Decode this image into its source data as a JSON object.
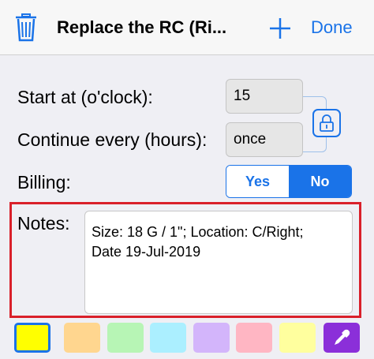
{
  "nav": {
    "title": "Replace the RC (Ri...",
    "done_label": "Done"
  },
  "form": {
    "start_label": "Start at (o'clock):",
    "start_value": "15",
    "continue_label": "Continue every (hours):",
    "continue_value": "once",
    "billing_label": "Billing:",
    "billing_options": [
      "Yes",
      "No"
    ],
    "billing_selected": "No",
    "notes_label": "Notes:",
    "notes_value": "Size: 18 G / 1\"; Location: C/Right;\nDate 19-Jul-2019"
  },
  "colors": {
    "accent": "#1a73e8",
    "highlight_frame": "#d9202a",
    "swatches": [
      "#ffff00",
      "#ffd68f",
      "#b7f5b5",
      "#abefff",
      "#d3b5fb",
      "#ffb6c3",
      "#ffff9e",
      "#8b2fd9"
    ]
  },
  "icons": [
    "trash-icon",
    "plus-icon",
    "lock-icon",
    "eyedropper-icon"
  ]
}
